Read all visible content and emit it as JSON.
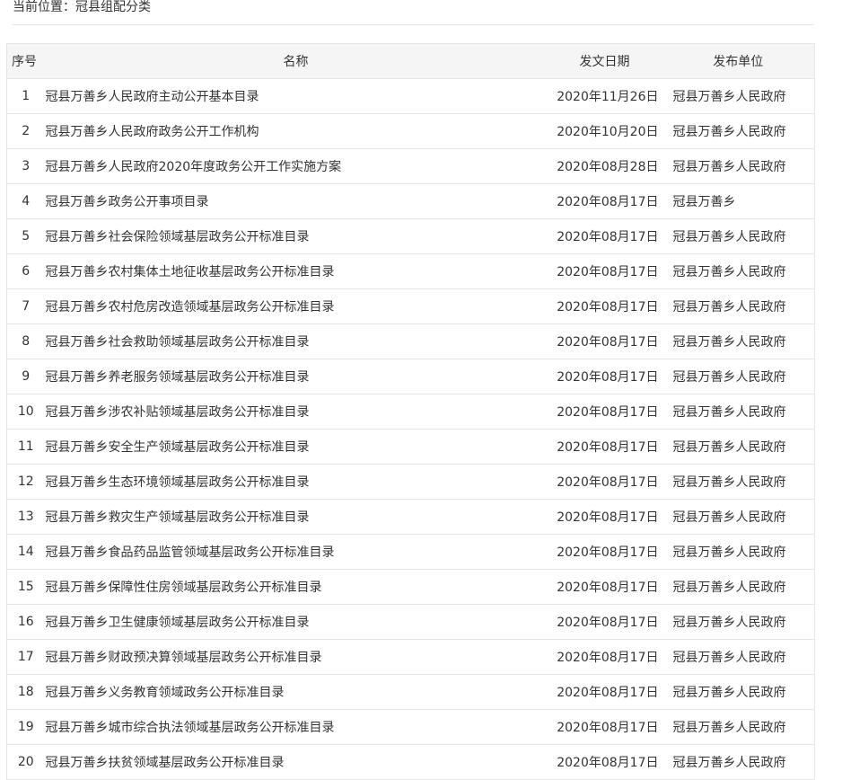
{
  "breadcrumb": {
    "label": "当前位置：冠县组配分类"
  },
  "table": {
    "headers": {
      "index": "序号",
      "title": "名称",
      "date": "发文日期",
      "unit": "发布单位"
    },
    "rows": [
      {
        "index": "1",
        "title": "冠县万善乡人民政府主动公开基本目录",
        "date": "2020年11月26日",
        "unit": "冠县万善乡人民政府"
      },
      {
        "index": "2",
        "title": "冠县万善乡人民政府政务公开工作机构",
        "date": "2020年10月20日",
        "unit": "冠县万善乡人民政府"
      },
      {
        "index": "3",
        "title": "冠县万善乡人民政府2020年度政务公开工作实施方案",
        "date": "2020年08月28日",
        "unit": "冠县万善乡人民政府"
      },
      {
        "index": "4",
        "title": "冠县万善乡政务公开事项目录",
        "date": "2020年08月17日",
        "unit": "冠县万善乡"
      },
      {
        "index": "5",
        "title": "冠县万善乡社会保险领域基层政务公开标准目录",
        "date": "2020年08月17日",
        "unit": "冠县万善乡人民政府"
      },
      {
        "index": "6",
        "title": "冠县万善乡农村集体土地征收基层政务公开标准目录",
        "date": "2020年08月17日",
        "unit": "冠县万善乡人民政府"
      },
      {
        "index": "7",
        "title": "冠县万善乡农村危房改造领域基层政务公开标准目录",
        "date": "2020年08月17日",
        "unit": "冠县万善乡人民政府"
      },
      {
        "index": "8",
        "title": "冠县万善乡社会救助领域基层政务公开标准目录",
        "date": "2020年08月17日",
        "unit": "冠县万善乡人民政府"
      },
      {
        "index": "9",
        "title": "冠县万善乡养老服务领域基层政务公开标准目录",
        "date": "2020年08月17日",
        "unit": "冠县万善乡人民政府"
      },
      {
        "index": "10",
        "title": "冠县万善乡涉农补贴领域基层政务公开标准目录",
        "date": "2020年08月17日",
        "unit": "冠县万善乡人民政府"
      },
      {
        "index": "11",
        "title": "冠县万善乡安全生产领域基层政务公开标准目录",
        "date": "2020年08月17日",
        "unit": "冠县万善乡人民政府"
      },
      {
        "index": "12",
        "title": "冠县万善乡生态环境领域基层政务公开标准目录",
        "date": "2020年08月17日",
        "unit": "冠县万善乡人民政府"
      },
      {
        "index": "13",
        "title": "冠县万善乡救灾生产领域基层政务公开标准目录",
        "date": "2020年08月17日",
        "unit": "冠县万善乡人民政府"
      },
      {
        "index": "14",
        "title": "冠县万善乡食品药品监管领域基层政务公开标准目录",
        "date": "2020年08月17日",
        "unit": "冠县万善乡人民政府"
      },
      {
        "index": "15",
        "title": "冠县万善乡保障性住房领域基层政务公开标准目录",
        "date": "2020年08月17日",
        "unit": "冠县万善乡人民政府"
      },
      {
        "index": "16",
        "title": "冠县万善乡卫生健康领域基层政务公开标准目录",
        "date": "2020年08月17日",
        "unit": "冠县万善乡人民政府"
      },
      {
        "index": "17",
        "title": "冠县万善乡财政预决算领域基层政务公开标准目录",
        "date": "2020年08月17日",
        "unit": "冠县万善乡人民政府"
      },
      {
        "index": "18",
        "title": "冠县万善乡义务教育领域政务公开标准目录",
        "date": "2020年08月17日",
        "unit": "冠县万善乡人民政府"
      },
      {
        "index": "19",
        "title": "冠县万善乡城市综合执法领域基层政务公开标准目录",
        "date": "2020年08月17日",
        "unit": "冠县万善乡人民政府"
      },
      {
        "index": "20",
        "title": "冠县万善乡扶贫领域基层政务公开标准目录",
        "date": "2020年08月17日",
        "unit": "冠县万善乡人民政府"
      }
    ]
  },
  "colors": {
    "text": "#333333",
    "header_bg": "#f5f5f5",
    "border": "#e6e6e6"
  }
}
